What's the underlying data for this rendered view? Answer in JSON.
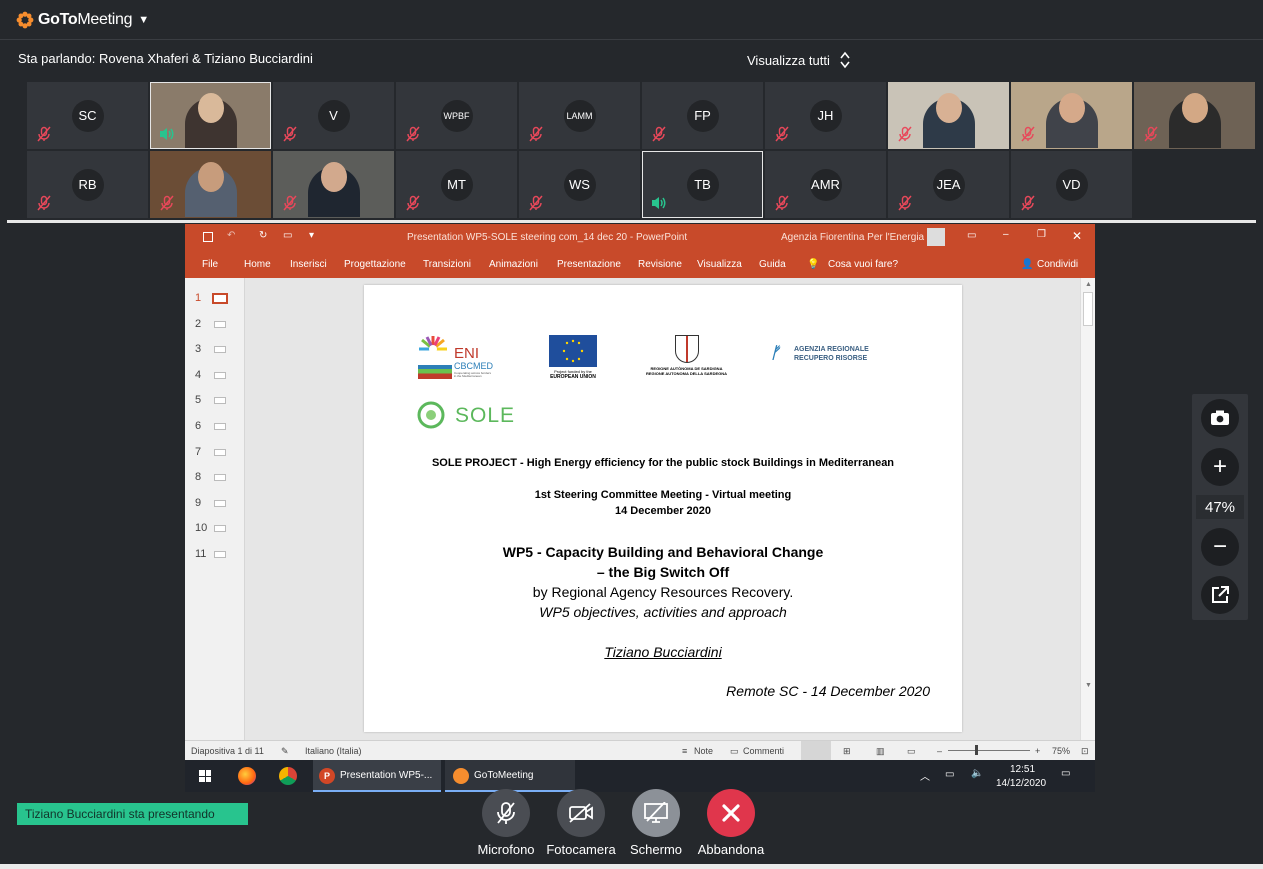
{
  "app": {
    "name_bold": "GoTo",
    "name_rest": "Meeting"
  },
  "header": {
    "speaking": "Sta parlando: Rovena Xhaferi & Tiziano Bucciardini",
    "view_all": "Visualizza tutti"
  },
  "participants": [
    {
      "initials": "SC",
      "mic": "muted",
      "video": false
    },
    {
      "initials": "",
      "mic": "speaking",
      "video": true
    },
    {
      "initials": "V",
      "mic": "muted",
      "video": false
    },
    {
      "initials": "WPBF",
      "mic": "muted",
      "video": false
    },
    {
      "initials": "LAMM",
      "mic": "muted",
      "video": false
    },
    {
      "initials": "FP",
      "mic": "muted",
      "video": false
    },
    {
      "initials": "JH",
      "mic": "muted",
      "video": false
    },
    {
      "initials": "",
      "mic": "muted",
      "video": true
    },
    {
      "initials": "",
      "mic": "muted",
      "video": true
    },
    {
      "initials": "",
      "mic": "muted",
      "video": true
    },
    {
      "initials": "RB",
      "mic": "muted",
      "video": false
    },
    {
      "initials": "",
      "mic": "muted",
      "video": true
    },
    {
      "initials": "",
      "mic": "muted",
      "video": true
    },
    {
      "initials": "MT",
      "mic": "muted",
      "video": false
    },
    {
      "initials": "WS",
      "mic": "muted",
      "video": false
    },
    {
      "initials": "TB",
      "mic": "speaking",
      "video": false
    },
    {
      "initials": "AMR",
      "mic": "muted",
      "video": false
    },
    {
      "initials": "JEA",
      "mic": "muted",
      "video": false
    },
    {
      "initials": "VD",
      "mic": "muted",
      "video": false
    }
  ],
  "powerpoint": {
    "title": "Presentation WP5-SOLE steering com_14 dec 20  -  PowerPoint",
    "user": "Agenzia Fiorentina Per l'Energia",
    "menu": [
      "File",
      "Home",
      "Inserisci",
      "Progettazione",
      "Transizioni",
      "Animazioni",
      "Presentazione",
      "Revisione",
      "Visualizza",
      "Guida"
    ],
    "tell_me": "Cosa vuoi fare?",
    "share": "Condividi",
    "slide_numbers": [
      "1",
      "2",
      "3",
      "4",
      "5",
      "6",
      "7",
      "8",
      "9",
      "10",
      "11"
    ],
    "status_slide": "Diapositiva 1 di 11",
    "status_lang": "Italiano (Italia)",
    "status_notes": "Note",
    "status_comments": "Commenti",
    "status_zoom": "75%"
  },
  "slide": {
    "eni": "ENI",
    "cbcmed": "CBCMED",
    "cbc_sub": "Cooperating across borders in the Mediterranean",
    "eu_sub": "Project funded by the",
    "eu_name": "EUROPEAN UNION",
    "sardinia": "REGIONE AUTÒNOMA DE SARDIGNA",
    "sardinia2": "REGIONE AUTONOMA DELLA SARDEGNA",
    "agency_line1": "AGENZIA REGIONALE",
    "agency_line2": "RECUPERO RISORSE",
    "sole": "SOLE",
    "project": "SOLE PROJECT - High Energy efficiency for the public stock Buildings in Mediterranean",
    "meeting": "1st Steering Committee Meeting - Virtual meeting",
    "date": "14 December 2020",
    "wp_title1": "WP5 - Capacity Building and Behavioral Change",
    "wp_title2": "– the Big Switch Off",
    "by": "by Regional Agency Resources Recovery.",
    "objectives": "WP5 objectives, activities and approach",
    "author": "Tiziano Bucciardini",
    "remote": "Remote SC - 14 December 2020"
  },
  "taskbar": {
    "ppt_item": "Presentation WP5-...",
    "gtm_item": "GoToMeeting",
    "time": "12:51",
    "date": "14/12/2020"
  },
  "zoom": {
    "percent": "47%"
  },
  "bottom": {
    "presenting": "Tiziano Bucciardini sta presentando",
    "mic_label": "Microfono",
    "camera_label": "Fotocamera",
    "screen_label": "Schermo",
    "leave_label": "Abbandona"
  },
  "colors": {
    "accent_green": "#28c48e",
    "muted_red": "#e8485a",
    "leave_red": "#e0364c",
    "ppt_orange": "#c84a2a"
  }
}
